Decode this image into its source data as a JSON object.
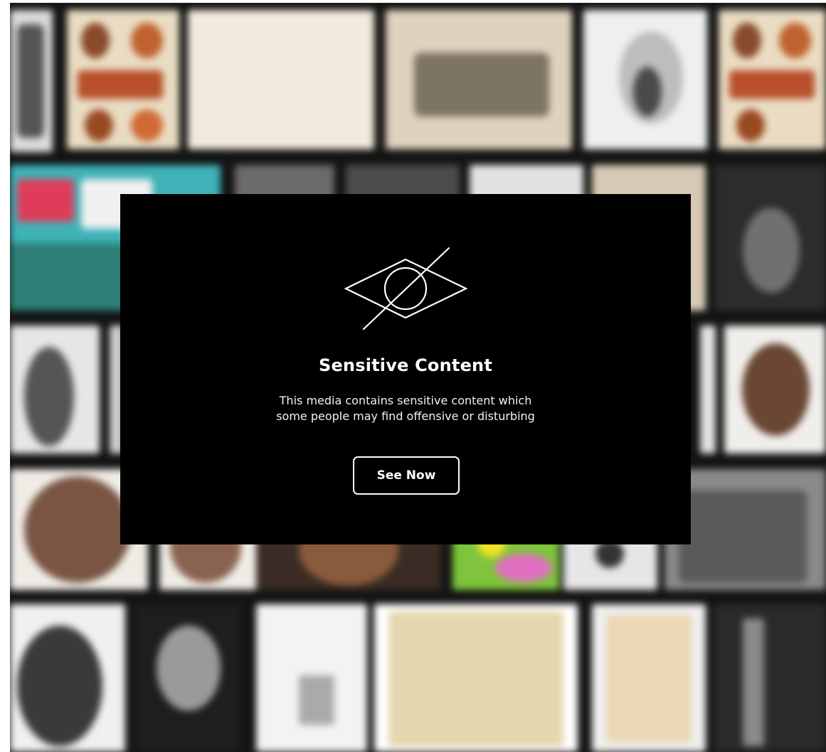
{
  "overlay": {
    "title": "Sensitive Content",
    "description_line1": "This media contains sensitive content which",
    "description_line2": "some people may find offensive or disturbing",
    "button_label": "See Now",
    "icon": "eye-slash-icon"
  },
  "colors": {
    "overlay_background": "#000000",
    "overlay_text": "#ffffff",
    "mosaic_background": "#141414"
  }
}
